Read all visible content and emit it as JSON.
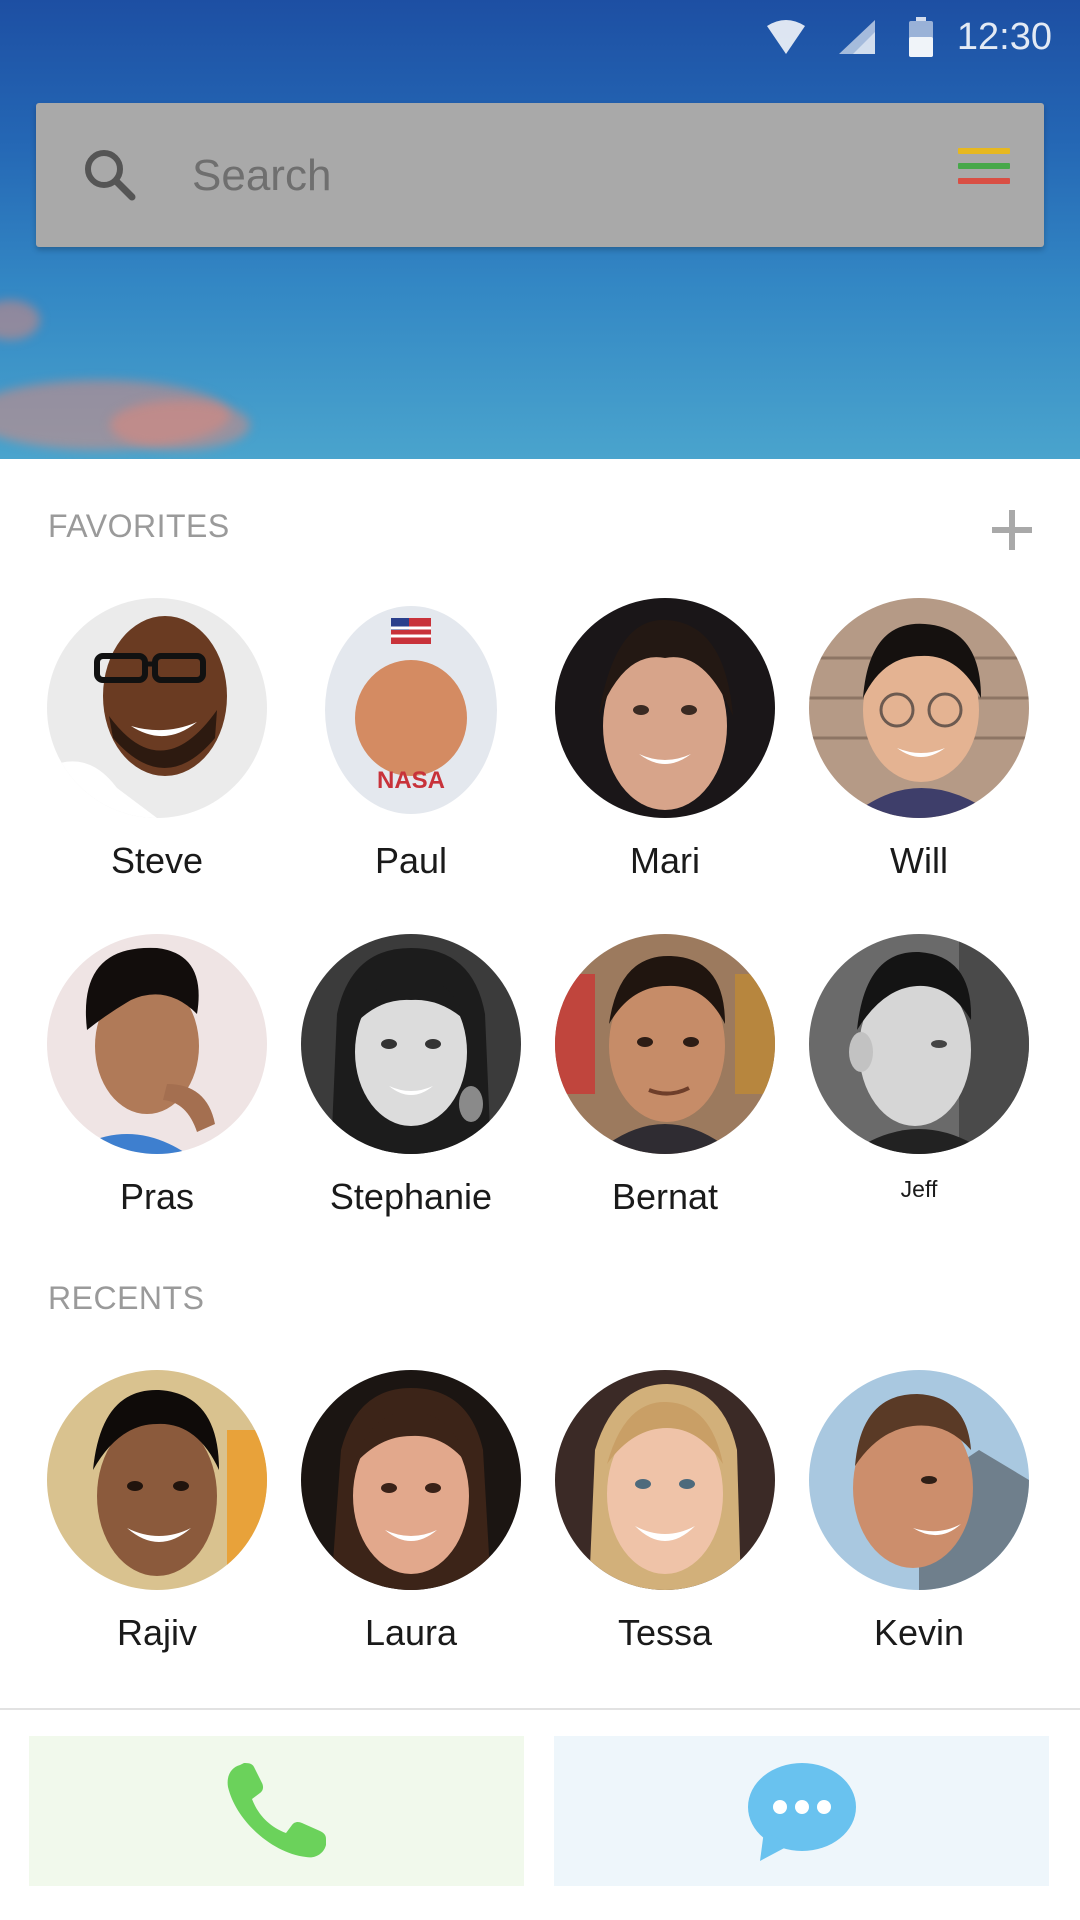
{
  "status_bar": {
    "time": "12:30",
    "icons": [
      "wifi-icon",
      "signal-icon",
      "battery-icon"
    ]
  },
  "search": {
    "placeholder": "Search",
    "search_icon": "search-icon",
    "menu_icon": "colored-menu-icon",
    "menu_colors": [
      "#e7b81f",
      "#47a84a",
      "#d94f44"
    ]
  },
  "favorites": {
    "title": "FAVORITES",
    "add_icon": "plus-icon",
    "contacts": [
      {
        "name": "Steve"
      },
      {
        "name": "Paul"
      },
      {
        "name": "Mari"
      },
      {
        "name": "Will"
      },
      {
        "name": "Pras"
      },
      {
        "name": "Stephanie"
      },
      {
        "name": "Bernat"
      },
      {
        "name": "Jeff"
      }
    ]
  },
  "recents": {
    "title": "RECENTS",
    "contacts": [
      {
        "name": "Rajiv"
      },
      {
        "name": "Laura"
      },
      {
        "name": "Tessa"
      },
      {
        "name": "Kevin"
      }
    ]
  },
  "actions": {
    "call_icon": "phone-icon",
    "message_icon": "chat-bubble-icon",
    "call_color": "#6bd25b",
    "message_color": "#69c2ef"
  },
  "colors": {
    "section_title": "#9a9a9a",
    "search_bar": "#a9a9a9",
    "call_bg": "#f1f9ec",
    "message_bg": "#eef6fb"
  }
}
